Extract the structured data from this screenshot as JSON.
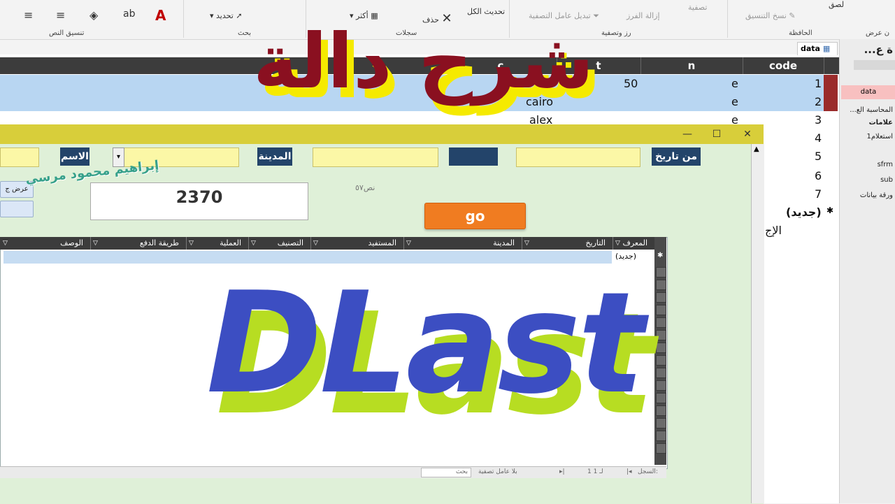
{
  "ribbon": {
    "groups": [
      "تنسيق النص",
      "بحث",
      "سجلات",
      "رز وتصفية",
      "الحافظة",
      "ن عرض"
    ],
    "text_items": {
      "select": "تحديد",
      "delete": "حذف",
      "more": "أكثر",
      "refresh_all": "تحديث الكل",
      "toggle_filter": "تبديل عامل التصفية",
      "clear_sort": "إزالة الفرز",
      "filter": "تصفية",
      "format_painter": "نسخ التنسيق",
      "paste": "لصق"
    }
  },
  "nav": {
    "title": "ة ع...",
    "items": [
      "data",
      "المحاسبة الع...",
      "علامات",
      "استعلام1",
      "sfrm",
      "sub",
      "ورقة بيانات"
    ]
  },
  "sheet": {
    "tab_name": "data",
    "columns": [
      "code",
      "n",
      "t",
      "c"
    ],
    "rows": [
      {
        "code": "1",
        "n": "e",
        "t": "50",
        "c": ""
      },
      {
        "code": "2",
        "n": "e",
        "t": "",
        "c": "cairo"
      },
      {
        "code": "3",
        "n": "e",
        "t": "",
        "c": "alex"
      },
      {
        "code": "4",
        "n": "",
        "t": "",
        "c": ""
      },
      {
        "code": "5",
        "n": "",
        "t": "",
        "c": ""
      },
      {
        "code": "6",
        "n": "",
        "t": "",
        "c": ""
      },
      {
        "code": "7",
        "n": "",
        "t": "",
        "c": ""
      }
    ],
    "new_row": "(جديد)",
    "total_label": "الإج"
  },
  "form": {
    "labels": {
      "from_date": "من تاريخ",
      "city": "المدينة",
      "name": "الاسم"
    },
    "total_value": "2370",
    "hint": "نص٥٧",
    "go": "go",
    "side_button": "عرض ج",
    "subgrid": {
      "columns": [
        "المعرف",
        "التاريخ",
        "المدينة",
        "المستفيد",
        "التصنيف",
        "العملية",
        "طريقة الدفع",
        "الوصف"
      ],
      "new_row": "(جديد)"
    },
    "record_nav": {
      "label": "السجل:",
      "position": "1 لـ 1",
      "no_filter": "بلا عامل تصفية",
      "search": "بحث"
    }
  },
  "overlay": {
    "arabic_title": "شرح دالة",
    "function_name": "DLast",
    "author": "إبراهيم محمود مرسي"
  },
  "colors": {
    "title_red": "#8a1020",
    "title_yellow": "#f5ea00",
    "dlast_blue": "#3c4ec2",
    "dlast_green": "#b7dd22",
    "form_green": "#dff0d8",
    "go_orange": "#f07c21",
    "label_navy": "#23446a"
  }
}
